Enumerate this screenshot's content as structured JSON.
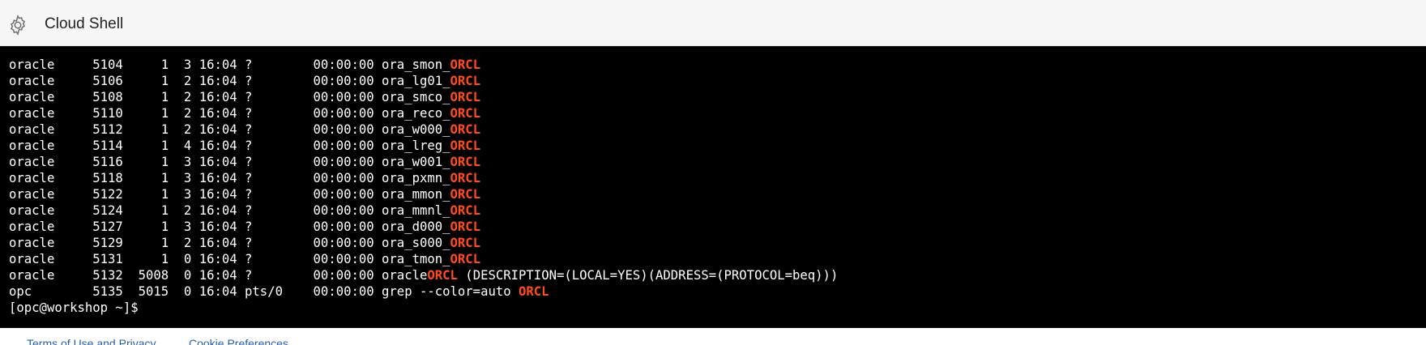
{
  "header": {
    "title": "Cloud Shell",
    "icon": "gear-icon"
  },
  "terminal": {
    "highlight_color": "#ff4b1f",
    "lines": [
      [
        {
          "t": "oracle     5104     1  3 16:04 ?        00:00:00 ora_smon_"
        },
        {
          "t": "ORCL",
          "hl": true
        }
      ],
      [
        {
          "t": "oracle     5106     1  2 16:04 ?        00:00:00 ora_lg01_"
        },
        {
          "t": "ORCL",
          "hl": true
        }
      ],
      [
        {
          "t": "oracle     5108     1  2 16:04 ?        00:00:00 ora_smco_"
        },
        {
          "t": "ORCL",
          "hl": true
        }
      ],
      [
        {
          "t": "oracle     5110     1  2 16:04 ?        00:00:00 ora_reco_"
        },
        {
          "t": "ORCL",
          "hl": true
        }
      ],
      [
        {
          "t": "oracle     5112     1  2 16:04 ?        00:00:00 ora_w000_"
        },
        {
          "t": "ORCL",
          "hl": true
        }
      ],
      [
        {
          "t": "oracle     5114     1  4 16:04 ?        00:00:00 ora_lreg_"
        },
        {
          "t": "ORCL",
          "hl": true
        }
      ],
      [
        {
          "t": "oracle     5116     1  3 16:04 ?        00:00:00 ora_w001_"
        },
        {
          "t": "ORCL",
          "hl": true
        }
      ],
      [
        {
          "t": "oracle     5118     1  3 16:04 ?        00:00:00 ora_pxmn_"
        },
        {
          "t": "ORCL",
          "hl": true
        }
      ],
      [
        {
          "t": "oracle     5122     1  3 16:04 ?        00:00:00 ora_mmon_"
        },
        {
          "t": "ORCL",
          "hl": true
        }
      ],
      [
        {
          "t": "oracle     5124     1  2 16:04 ?        00:00:00 ora_mmnl_"
        },
        {
          "t": "ORCL",
          "hl": true
        }
      ],
      [
        {
          "t": "oracle     5127     1  3 16:04 ?        00:00:00 ora_d000_"
        },
        {
          "t": "ORCL",
          "hl": true
        }
      ],
      [
        {
          "t": "oracle     5129     1  2 16:04 ?        00:00:00 ora_s000_"
        },
        {
          "t": "ORCL",
          "hl": true
        }
      ],
      [
        {
          "t": "oracle     5131     1  0 16:04 ?        00:00:00 ora_tmon_"
        },
        {
          "t": "ORCL",
          "hl": true
        }
      ],
      [
        {
          "t": "oracle     5132  5008  0 16:04 ?        00:00:00 oracle"
        },
        {
          "t": "ORCL",
          "hl": true
        },
        {
          "t": " (DESCRIPTION=(LOCAL=YES)(ADDRESS=(PROTOCOL=beq)))"
        }
      ],
      [
        {
          "t": "opc        5135  5015  0 16:04 pts/0    00:00:00 grep --color=auto "
        },
        {
          "t": "ORCL",
          "hl": true
        }
      ],
      [
        {
          "t": "[opc@workshop ~]$ "
        }
      ]
    ]
  },
  "footer": {
    "links": [
      {
        "label": "Terms of Use and Privacy"
      },
      {
        "label": "Cookie Preferences"
      }
    ]
  }
}
